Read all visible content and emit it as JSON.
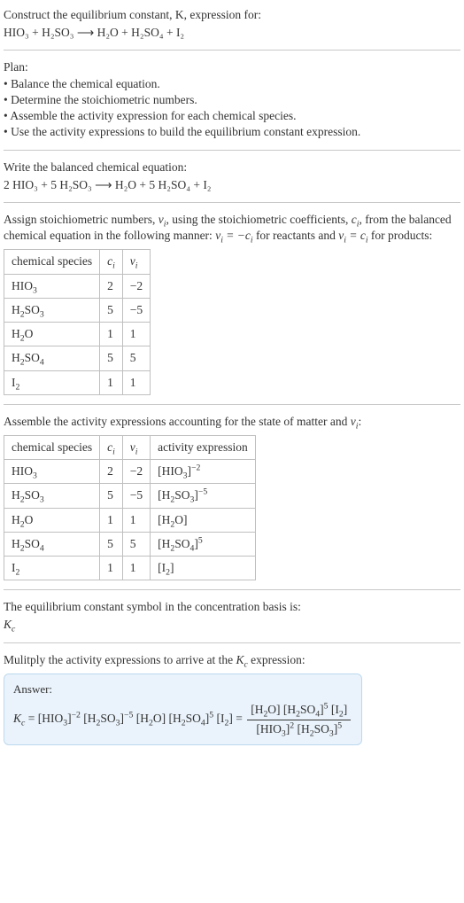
{
  "intro": {
    "prompt": "Construct the equilibrium constant, K, expression for:",
    "unbalanced_eq": "HIO₃ + H₂SO₃  ⟶  H₂O + H₂SO₄ + I₂"
  },
  "plan": {
    "heading": "Plan:",
    "items": [
      "Balance the chemical equation.",
      "Determine the stoichiometric numbers.",
      "Assemble the activity expression for each chemical species.",
      "Use the activity expressions to build the equilibrium constant expression."
    ]
  },
  "balanced": {
    "heading": "Write the balanced chemical equation:",
    "eq": "2 HIO₃ + 5 H₂SO₃  ⟶  H₂O + 5 H₂SO₄ + I₂"
  },
  "stoich": {
    "heading_before": "Assign stoichiometric numbers, ",
    "nu": "νᵢ",
    "heading_mid1": ", using the stoichiometric coefficients, ",
    "ci": "cᵢ",
    "heading_mid2": ", from the balanced chemical equation in the following manner: ",
    "rel_reactants": "νᵢ = −cᵢ",
    "heading_mid3": " for reactants and ",
    "rel_products": "νᵢ = cᵢ",
    "heading_after": " for products:",
    "cols": [
      "chemical species",
      "cᵢ",
      "νᵢ"
    ],
    "rows": [
      {
        "sp": "HIO₃",
        "c": "2",
        "nu": "−2"
      },
      {
        "sp": "H₂SO₃",
        "c": "5",
        "nu": "−5"
      },
      {
        "sp": "H₂O",
        "c": "1",
        "nu": "1"
      },
      {
        "sp": "H₂SO₄",
        "c": "5",
        "nu": "5"
      },
      {
        "sp": "I₂",
        "c": "1",
        "nu": "1"
      }
    ]
  },
  "activity": {
    "heading_before": "Assemble the activity expressions accounting for the state of matter and ",
    "nu": "νᵢ",
    "heading_after": ":",
    "cols": [
      "chemical species",
      "cᵢ",
      "νᵢ",
      "activity expression"
    ],
    "rows": [
      {
        "sp": "HIO₃",
        "c": "2",
        "nu": "−2",
        "base": "[HIO₃]",
        "exp": "−2"
      },
      {
        "sp": "H₂SO₃",
        "c": "5",
        "nu": "−5",
        "base": "[H₂SO₃]",
        "exp": "−5"
      },
      {
        "sp": "H₂O",
        "c": "1",
        "nu": "1",
        "base": "[H₂O]",
        "exp": ""
      },
      {
        "sp": "H₂SO₄",
        "c": "5",
        "nu": "5",
        "base": "[H₂SO₄]",
        "exp": "5"
      },
      {
        "sp": "I₂",
        "c": "1",
        "nu": "1",
        "base": "[I₂]",
        "exp": ""
      }
    ]
  },
  "kconst": {
    "heading": "The equilibrium constant symbol in the concentration basis is:",
    "symbol": "K_c"
  },
  "multiply": {
    "heading_before": "Mulitply the activity expressions to arrive at the ",
    "kc": "K_c",
    "heading_after": " expression:"
  },
  "answer": {
    "label": "Answer:",
    "kc": "K_c",
    "left_terms": [
      {
        "base": "[HIO₃]",
        "exp": "−2"
      },
      {
        "base": "[H₂SO₃]",
        "exp": "−5"
      },
      {
        "base": "[H₂O]",
        "exp": ""
      },
      {
        "base": "[H₂SO₄]",
        "exp": "5"
      },
      {
        "base": "[I₂]",
        "exp": ""
      }
    ],
    "num_terms": [
      {
        "base": "[H₂O]",
        "exp": ""
      },
      {
        "base": "[H₂SO₄]",
        "exp": "5"
      },
      {
        "base": "[I₂]",
        "exp": ""
      }
    ],
    "den_terms": [
      {
        "base": "[HIO₃]",
        "exp": "2"
      },
      {
        "base": "[H₂SO₃]",
        "exp": "5"
      }
    ]
  }
}
